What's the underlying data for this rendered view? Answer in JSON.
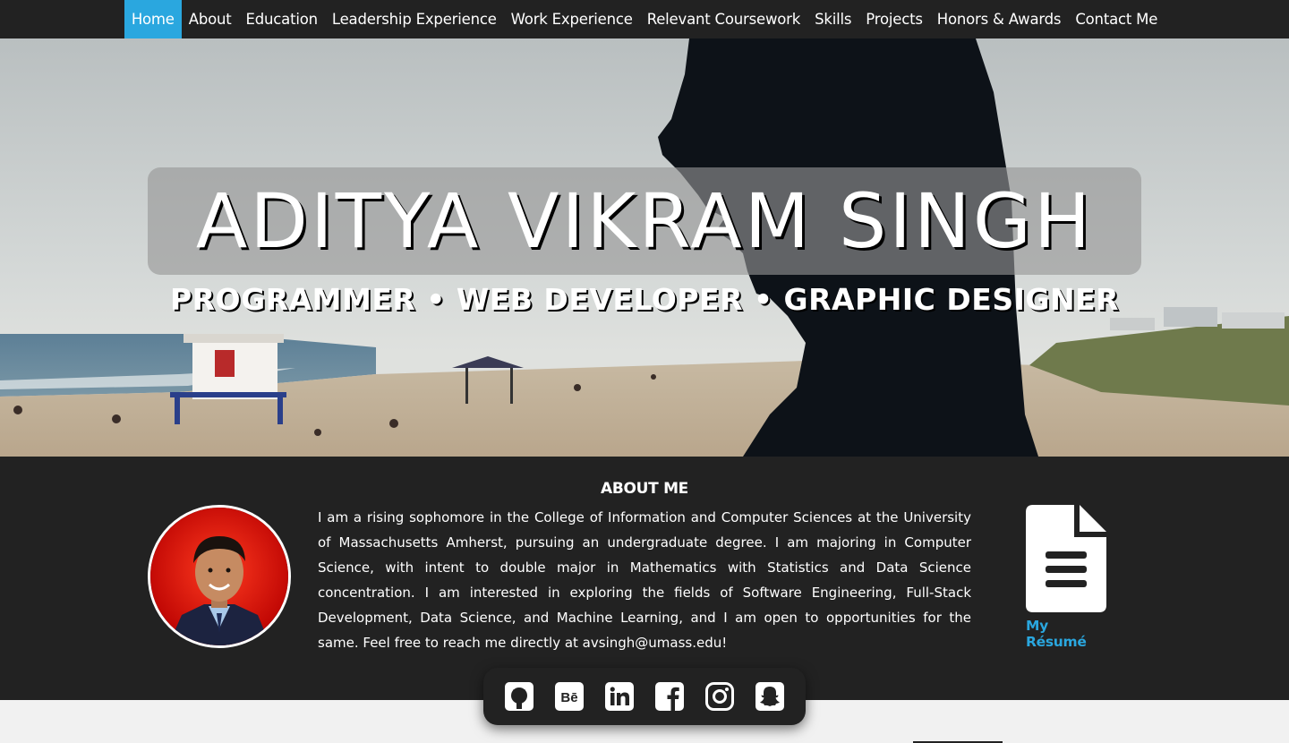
{
  "nav": {
    "items": [
      {
        "label": "Home",
        "active": true
      },
      {
        "label": "About"
      },
      {
        "label": "Education"
      },
      {
        "label": "Leadership Experience"
      },
      {
        "label": "Work Experience"
      },
      {
        "label": "Relevant Coursework"
      },
      {
        "label": "Skills"
      },
      {
        "label": "Projects"
      },
      {
        "label": "Honors & Awards"
      },
      {
        "label": "Contact Me"
      }
    ]
  },
  "hero": {
    "name": "ADITYA VIKRAM SINGH",
    "tagline": "PROGRAMMER • WEB DEVELOPER • GRAPHIC DESIGNER"
  },
  "about": {
    "title": "ABOUT ME",
    "text": "I am a rising sophomore in the College of Information and Computer Sciences at the University of Massachusetts Amherst, pursuing an undergraduate degree. I am majoring in Computer Science, with intent to double major in Mathematics with Statistics and Data Science concentration. I am interested in exploring the fields of Software Engineering, Full-Stack Development, Data Science, and Machine Learning, and I am open to opportunities for the same. Feel free to reach me directly at avsingh@umass.edu!",
    "resume_label": "My Résumé"
  },
  "social": {
    "icons": [
      "github-icon",
      "behance-icon",
      "linkedin-icon",
      "facebook-icon",
      "instagram-icon",
      "snapchat-icon"
    ]
  },
  "colors": {
    "accent": "#2aa7df",
    "dark": "#222222",
    "light": "#f1f1f1"
  }
}
